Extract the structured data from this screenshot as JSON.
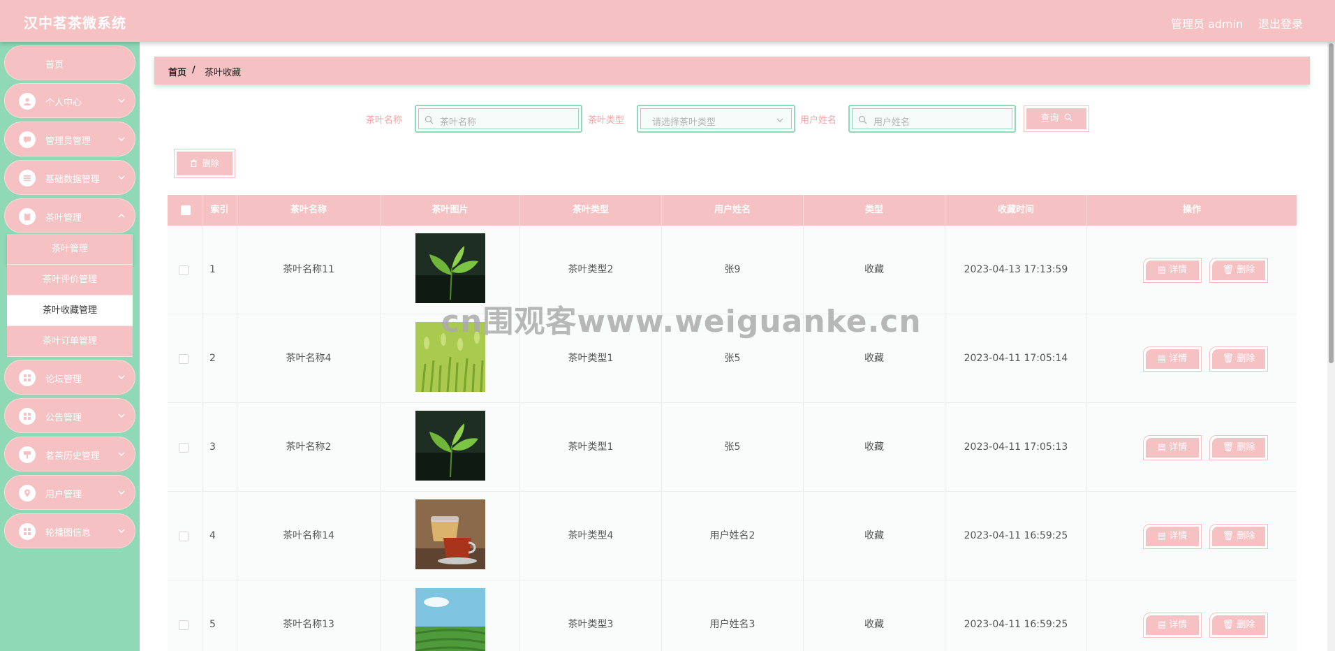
{
  "app": {
    "title": "汉中茗茶微系统"
  },
  "header": {
    "admin_label": "管理员 admin",
    "logout_label": "退出登录"
  },
  "sidebar": {
    "items": [
      {
        "label": "首页"
      },
      {
        "label": "个人中心"
      },
      {
        "label": "管理员管理"
      },
      {
        "label": "基础数据管理"
      },
      {
        "label": "茶叶管理"
      },
      {
        "label": "论坛管理"
      },
      {
        "label": "公告管理"
      },
      {
        "label": "茗茶历史管理"
      },
      {
        "label": "用户管理"
      },
      {
        "label": "轮播图信息"
      }
    ],
    "submenu": [
      {
        "label": "茶叶管理"
      },
      {
        "label": "茶叶评价管理"
      },
      {
        "label": "茶叶收藏管理"
      },
      {
        "label": "茶叶订单管理"
      }
    ]
  },
  "breadcrumb": {
    "home": "首页",
    "separator": "/",
    "current": "茶叶收藏"
  },
  "search": {
    "name_label": "茶叶名称",
    "name_placeholder": "茶叶名称",
    "type_label": "茶叶类型",
    "type_placeholder": "请选择茶叶类型",
    "user_label": "用户姓名",
    "user_placeholder": "用户姓名",
    "query_label": "查询"
  },
  "toolbar": {
    "delete_label": "删除"
  },
  "table": {
    "columns": [
      "索引",
      "茶叶名称",
      "茶叶图片",
      "茶叶类型",
      "用户姓名",
      "类型",
      "收藏时间",
      "操作"
    ],
    "detail_label": "详情",
    "delete_label": "删除",
    "rows": [
      {
        "index": "1",
        "name": "茶叶名称11",
        "image": "tea-leaf-dark",
        "type": "茶叶类型2",
        "user": "张9",
        "kind": "收藏",
        "time": "2023-04-13 17:13:59"
      },
      {
        "index": "2",
        "name": "茶叶名称4",
        "image": "tea-field-green",
        "type": "茶叶类型1",
        "user": "张5",
        "kind": "收藏",
        "time": "2023-04-11 17:05:14"
      },
      {
        "index": "3",
        "name": "茶叶名称2",
        "image": "tea-leaf-dark",
        "type": "茶叶类型1",
        "user": "张5",
        "kind": "收藏",
        "time": "2023-04-11 17:05:13"
      },
      {
        "index": "4",
        "name": "茶叶名称14",
        "image": "tea-cup",
        "type": "茶叶类型4",
        "user": "用户姓名2",
        "kind": "收藏",
        "time": "2023-04-11 16:59:25"
      },
      {
        "index": "5",
        "name": "茶叶名称13",
        "image": "tea-plantation",
        "type": "茶叶类型3",
        "user": "用户姓名3",
        "kind": "收藏",
        "time": "2023-04-11 16:59:25"
      }
    ]
  },
  "watermark": "cn围观客www.weiguanke.cn",
  "colors": {
    "primary": "#f6c1c3",
    "sidebar": "#8fd9b6",
    "accent_green": "#8fd9b6"
  }
}
